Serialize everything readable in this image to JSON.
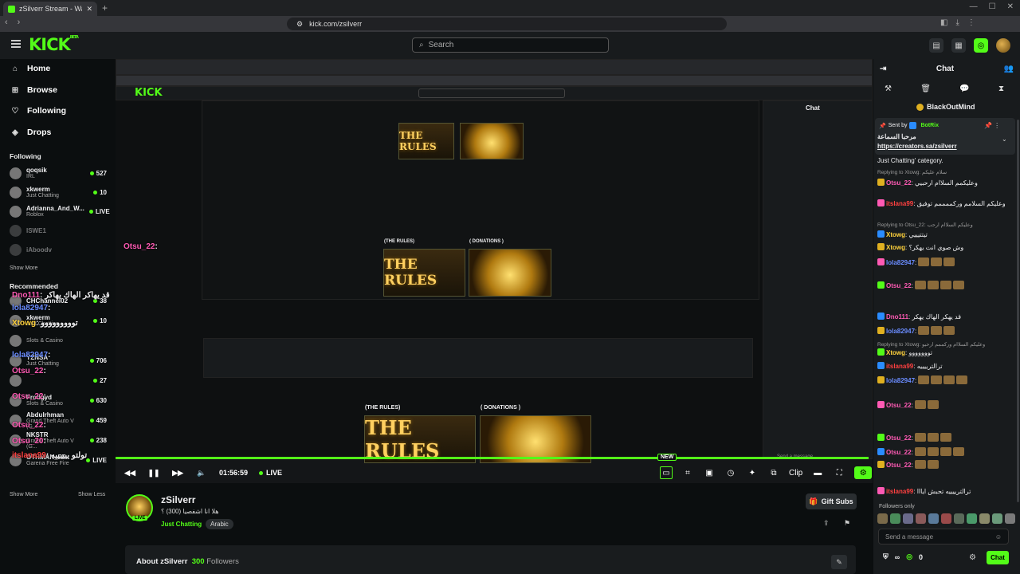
{
  "browser": {
    "tab_title": "zSilverr Stream - Watch Live",
    "url": "kick.com/zsilverr"
  },
  "header": {
    "logo": "KICK",
    "logo_sup": "BETA",
    "search_placeholder": "Search"
  },
  "sidebar": {
    "nav": [
      {
        "label": "Home",
        "icon": "home-icon"
      },
      {
        "label": "Browse",
        "icon": "browse-icon"
      },
      {
        "label": "Following",
        "icon": "heart-icon"
      },
      {
        "label": "Drops",
        "icon": "drops-icon"
      }
    ],
    "following_title": "Following",
    "following": [
      {
        "name": "qoqsik",
        "sub": "IRL",
        "count": "527"
      },
      {
        "name": "xkwerm",
        "sub": "Just Chatting",
        "count": "10"
      },
      {
        "name": "Adrianna_And_W...",
        "sub": "Roblox",
        "count": "LIVE"
      },
      {
        "name": "ISWE1",
        "sub": "",
        "count": ""
      },
      {
        "name": "iAboodv",
        "sub": "",
        "count": ""
      }
    ],
    "show_more": "Show More",
    "recommended_title": "Recommended",
    "recommended": [
      {
        "name": "CHChannel02",
        "sub": "",
        "count": "38"
      },
      {
        "name": "xkwerm",
        "sub": "Just Chatting",
        "count": "10"
      },
      {
        "name": "",
        "sub": "Slots & Casino",
        "count": ""
      },
      {
        "name": "YZNSA",
        "sub": "Just Chatting",
        "count": "706"
      },
      {
        "name": "",
        "sub": "",
        "count": "27"
      },
      {
        "name": "Frodgyd",
        "sub": "Slots & Casino",
        "count": "630"
      },
      {
        "name": "Abdulrhman",
        "sub": "Grand Theft Auto V (G...",
        "count": "459"
      },
      {
        "name": "NKSTR",
        "sub": "Grand Theft Auto V (G...",
        "count": "238"
      },
      {
        "name": "OTHMAN_FF",
        "sub": "Garena Free Fire",
        "count": "LIVE"
      }
    ],
    "show_more_2": "Show More",
    "show_less": "Show Less"
  },
  "overlay_chat": [
    {
      "user": "Otsu_22",
      "msg": ":",
      "color": "#ff5ab4"
    },
    {
      "user": "Dno111",
      "msg": ": قد يهاكر الهاك يهاكر",
      "color": "#ff5ab4"
    },
    {
      "user": "lola82947",
      "msg": ":",
      "color": "#6a8cff"
    },
    {
      "user": "Xtowg",
      "msg": ": تووووووووو",
      "color": "#ffd23c"
    },
    {
      "user": "lola82947",
      "msg": ":",
      "color": "#6a8cff"
    },
    {
      "user": "Otsu_22",
      "msg": ":",
      "color": "#ff5ab4"
    },
    {
      "user": "Otsu_22",
      "msg": ":",
      "color": "#ff5ab4"
    },
    {
      "user": "Otsu_22",
      "msg": ":",
      "color": "#ff5ab4"
    },
    {
      "user": "Otsu_20",
      "msg": ":",
      "color": "#ff5ab4"
    },
    {
      "user": "itslana99",
      "msg": ": تولتو ييييييه",
      "color": "#ff4040"
    }
  ],
  "player": {
    "time": "01:56:59",
    "live": "LIVE",
    "new_badge": "NEW",
    "clip_label": "Clip"
  },
  "inner_stream": {
    "rules_label": "(THE RULES)",
    "donations_label": "( DONATIONS )",
    "banner_text": "THE RULES"
  },
  "channel": {
    "name": "zSilverr",
    "title": "هلا انا اشفصيا (300) ؟",
    "category": "Just Chatting",
    "language": "Arabic",
    "live_badge": "LIVE",
    "gift_subs": "Gift Subs",
    "about_prefix": "About zSilverr",
    "followers_count": "300",
    "followers_label": "Followers"
  },
  "chat": {
    "title": "Chat",
    "top_user": "BlackOutMind",
    "pinned_sent_by": "Sent by",
    "pinned_bot": "BotRix",
    "pinned_msg": "مرحبا السماعة",
    "pinned_url": "https://creators.sa/zsilverr",
    "messages": [
      {
        "type": "text",
        "text": "Just Chatting' category."
      },
      {
        "type": "reply",
        "text": "Replying to Xtowg: سلام عليكم"
      },
      {
        "type": "msg",
        "user": "Otsu_22",
        "color": "#ff5ab4",
        "text": "وعليكمم السلاام ارحبيي"
      },
      {
        "type": "msg",
        "user": "itslana99",
        "color": "#ff4040",
        "text": "وعليكم السلامم وركممممم توفيق"
      },
      {
        "type": "reply",
        "text": "Replying to Otsu_22: وعليكم السلاام ارحب"
      },
      {
        "type": "msg",
        "user": "Xtowg",
        "color": "#ffd23c",
        "text": "تيتتيييي"
      },
      {
        "type": "msg",
        "user": "Xtowg",
        "color": "#ffd23c",
        "text": "وش صوي انت يهكر؟"
      },
      {
        "type": "msg",
        "user": "lola82947",
        "color": "#6a8cff",
        "text": ""
      },
      {
        "type": "msg",
        "user": "Otsu_22",
        "color": "#ff5ab4",
        "text": ""
      },
      {
        "type": "msg",
        "user": "Dno111",
        "color": "#ff5ab4",
        "text": "قد يهكر الهاك يهكر"
      },
      {
        "type": "msg",
        "user": "lola82947",
        "color": "#6a8cff",
        "text": ""
      },
      {
        "type": "reply",
        "text": "Replying to Xtowg: وعليكم السلاام وركممم ارحبو"
      },
      {
        "type": "msg",
        "user": "Xtowg",
        "color": "#ffd23c",
        "text": "تووووووو"
      },
      {
        "type": "msg",
        "user": "itslana99",
        "color": "#ff4040",
        "text": "ترالترييييه"
      },
      {
        "type": "msg",
        "user": "lola82947",
        "color": "#6a8cff",
        "text": ""
      },
      {
        "type": "msg",
        "user": "Otsu_22",
        "color": "#ff5ab4",
        "text": ""
      },
      {
        "type": "msg",
        "user": "Otsu_22",
        "color": "#ff5ab4",
        "text": ""
      },
      {
        "type": "msg",
        "user": "Otsu_22",
        "color": "#ff5ab4",
        "text": ""
      },
      {
        "type": "msg",
        "user": "Otsu_22",
        "color": "#ff5ab4",
        "text": ""
      },
      {
        "type": "msg",
        "user": "itslana99",
        "color": "#ff4040",
        "text": "ترالترييييه تحبش ايااا"
      }
    ],
    "followers_only": "Followers only",
    "input_placeholder": "Send a message",
    "points": "0",
    "chat_button": "Chat"
  },
  "colors": {
    "accent": "#53fc18",
    "bg": "#0b0e0f",
    "panel": "#181b1d"
  }
}
